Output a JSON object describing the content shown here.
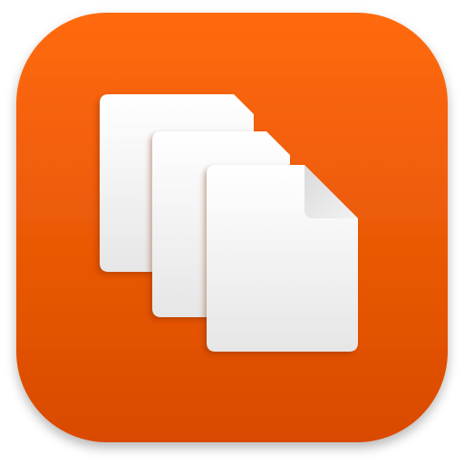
{
  "app_icon": {
    "icon": "stacked-documents-icon",
    "colors": {
      "background_top": "#FF6A0D",
      "background_bottom": "#D94A00",
      "page_light": "#FFFFFF",
      "page_shade": "#E6E6E6",
      "fold": "#F2F2F2"
    }
  }
}
